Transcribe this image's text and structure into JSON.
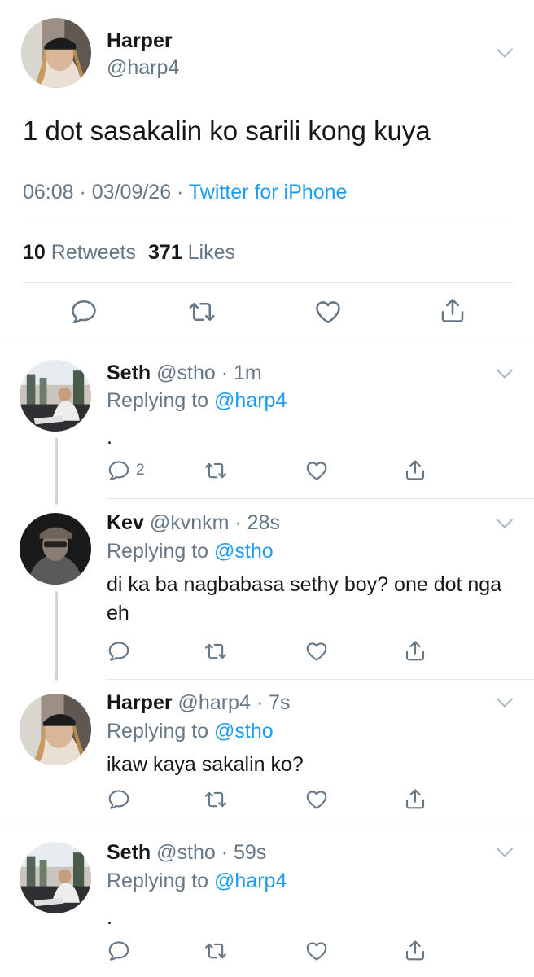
{
  "main_tweet": {
    "name": "Harper",
    "handle": "@harp4",
    "text": "1 dot sasakalin ko sarili kong kuya",
    "time": "06:08",
    "date": "03/09/26",
    "client": "Twitter for iPhone",
    "retweets_count": "10",
    "retweets_label": "Retweets",
    "likes_count": "371",
    "likes_label": "Likes",
    "separator": " · "
  },
  "replies": [
    {
      "name": "Seth",
      "handle": "@stho",
      "time": "1m",
      "replying_label": "Replying to",
      "replying_to": "@harp4",
      "text": ".",
      "reply_count": "2"
    },
    {
      "name": "Kev",
      "handle": "@kvnkm",
      "time": "28s",
      "replying_label": "Replying to",
      "replying_to": "@stho",
      "text": "di ka ba nagbabasa sethy boy? one dot nga eh",
      "reply_count": ""
    },
    {
      "name": "Harper",
      "handle": "@harp4",
      "time": "7s",
      "replying_label": "Replying to",
      "replying_to": "@stho",
      "text": "ikaw kaya sakalin ko?",
      "reply_count": ""
    },
    {
      "name": "Seth",
      "handle": "@stho",
      "time": "59s",
      "replying_label": "Replying to",
      "replying_to": "@harp4",
      "text": ".",
      "reply_count": ""
    }
  ],
  "icons": {
    "reply": "reply-icon",
    "retweet": "retweet-icon",
    "like": "heart-icon",
    "share": "share-icon",
    "more": "chevron-down-icon"
  },
  "colors": {
    "link": "#1d9bf0",
    "muted": "#657786",
    "text": "#14171a",
    "divider": "#e1e8ed"
  }
}
